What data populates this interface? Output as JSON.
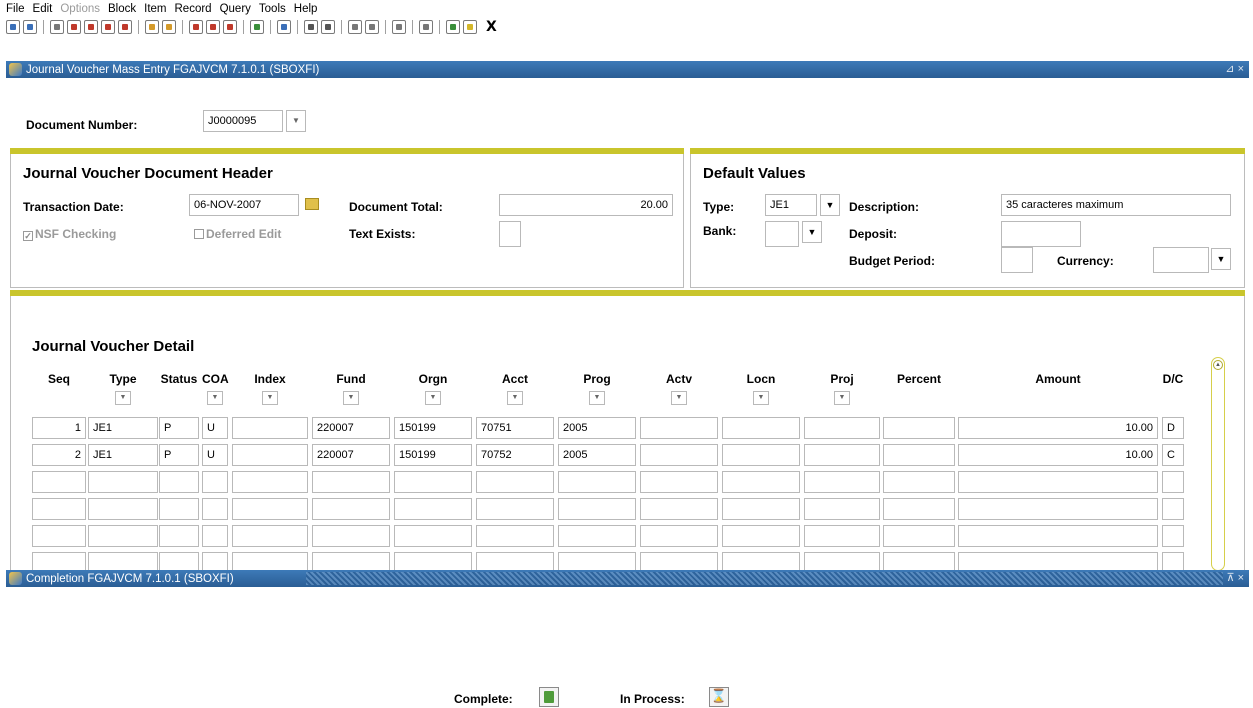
{
  "menu": [
    "File",
    "Edit",
    "Options",
    "Block",
    "Item",
    "Record",
    "Query",
    "Tools",
    "Help"
  ],
  "menu_disabled": [
    "Options"
  ],
  "toolbar_icons": [
    {
      "name": "save-icon",
      "color": "#3a6fb8"
    },
    {
      "name": "rollback-icon",
      "color": "#3a6fb8"
    },
    {
      "name": "print-icon",
      "color": "#777777"
    },
    {
      "name": "select-icon",
      "color": "#c0392b"
    },
    {
      "name": "previous-block-icon",
      "color": "#c0392b"
    },
    {
      "name": "next-block-icon",
      "color": "#c0392b"
    },
    {
      "name": "exit-block-icon",
      "color": "#c0392b"
    },
    {
      "name": "previous-record-icon",
      "color": "#d49a2a"
    },
    {
      "name": "next-record-icon",
      "color": "#d49a2a"
    },
    {
      "name": "insert-record-icon",
      "color": "#c0392b"
    },
    {
      "name": "remove-record-icon",
      "color": "#c0392b"
    },
    {
      "name": "delete-record-icon",
      "color": "#c0392b"
    },
    {
      "name": "duplicate-icon",
      "color": "#3a8f3a"
    },
    {
      "name": "printer-icon",
      "color": "#3a6fb8"
    },
    {
      "name": "enter-query-icon",
      "color": "#555555"
    },
    {
      "name": "execute-query-icon",
      "color": "#555555"
    },
    {
      "name": "cancel-query-icon",
      "color": "#777777"
    },
    {
      "name": "list-icon",
      "color": "#777777"
    },
    {
      "name": "attachment-icon",
      "color": "#777777"
    },
    {
      "name": "help-icon",
      "color": "#777777"
    },
    {
      "name": "info-icon",
      "color": "#3a8f3a"
    },
    {
      "name": "bulb-icon",
      "color": "#d4b72a"
    }
  ],
  "toolbar_exit": "X",
  "window_title": "Journal Voucher Mass Entry  FGAJVCM  7.1.0.1  (SBOXFI)",
  "window_controls": "⊿ ×",
  "doc_number": {
    "label": "Document Number:",
    "value": "J0000095"
  },
  "header": {
    "title": "Journal Voucher Document Header",
    "trans_date_label": "Transaction Date:",
    "trans_date": "06-NOV-2007",
    "doc_total_label": "Document Total:",
    "doc_total": "20.00",
    "nsf_label": "NSF Checking",
    "deferred_label": "Deferred Edit",
    "text_exists_label": "Text Exists:"
  },
  "defaults": {
    "title": "Default Values",
    "type_label": "Type:",
    "type_value": "JE1",
    "bank_label": "Bank:",
    "description_label": "Description:",
    "description_value": "35 caracteres maximum",
    "deposit_label": "Deposit:",
    "budget_label": "Budget Period:",
    "currency_label": "Currency:"
  },
  "detail": {
    "title": "Journal Voucher Detail",
    "columns": [
      "Seq",
      "Type",
      "Status",
      "COA",
      "Index",
      "Fund",
      "Orgn",
      "Acct",
      "Prog",
      "Actv",
      "Locn",
      "Proj",
      "Percent",
      "Amount",
      "D/C"
    ],
    "rows": [
      [
        "1",
        "JE1",
        "P",
        "U",
        "",
        "220007",
        "150199",
        "70751",
        "2005",
        "",
        "",
        "",
        "",
        "10.00",
        "D"
      ],
      [
        "2",
        "JE1",
        "P",
        "U",
        "",
        "220007",
        "150199",
        "70752",
        "2005",
        "",
        "",
        "",
        "",
        "10.00",
        "C"
      ],
      [
        "",
        "",
        "",
        "",
        "",
        "",
        "",
        "",
        "",
        "",
        "",
        "",
        "",
        "",
        ""
      ],
      [
        "",
        "",
        "",
        "",
        "",
        "",
        "",
        "",
        "",
        "",
        "",
        "",
        "",
        "",
        ""
      ],
      [
        "",
        "",
        "",
        "",
        "",
        "",
        "",
        "",
        "",
        "",
        "",
        "",
        "",
        "",
        ""
      ],
      [
        "",
        "",
        "",
        "",
        "",
        "",
        "",
        "",
        "",
        "",
        "",
        "",
        "",
        "",
        ""
      ]
    ]
  },
  "completion": {
    "window_title": "Completion  FGAJVCM  7.1.0.1  (SBOXFI)",
    "window_controls": "⊼ ×",
    "complete_label": "Complete:",
    "in_process_label": "In Process:",
    "in_process_glyph": "⌛"
  }
}
